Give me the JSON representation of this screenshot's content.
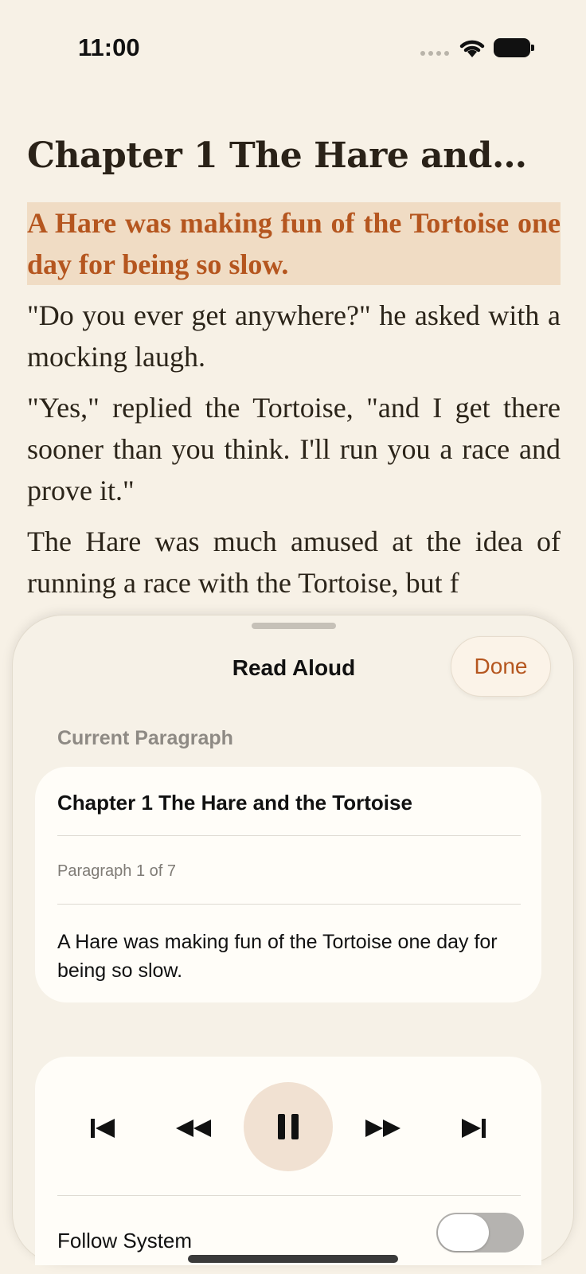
{
  "status_bar": {
    "time": "11:00"
  },
  "reader": {
    "chapter_title": "Chapter 1 The Hare and t...",
    "paragraphs": [
      "A Hare was making fun of the Tortoise one day for being so slow.",
      "\"Do you ever get anywhere?\" he asked with a mocking laugh.",
      "\"Yes,\" replied the Tortoise, \"and I get there sooner than you think. I'll run you a race and prove it.\"",
      "The Hare was much amused at the idea of running a race with the Tortoise, but f"
    ],
    "highlight_color": "#b5561f",
    "highlight_bg": "#f0dcc4"
  },
  "sheet": {
    "title": "Read Aloud",
    "done_label": "Done",
    "section_label": "Current Paragraph",
    "paragraph_card": {
      "chapter": "Chapter 1 The Hare and the Tortoise",
      "position": "Paragraph 1 of 7",
      "text": "A Hare was making fun of the Tortoise one day for being so slow."
    },
    "player": {
      "controls": [
        "skip-to-start-icon",
        "rewind-icon",
        "pause-icon",
        "fast-forward-icon",
        "skip-to-end-icon"
      ],
      "follow_system_label": "Follow System",
      "follow_system_on": false
    }
  }
}
